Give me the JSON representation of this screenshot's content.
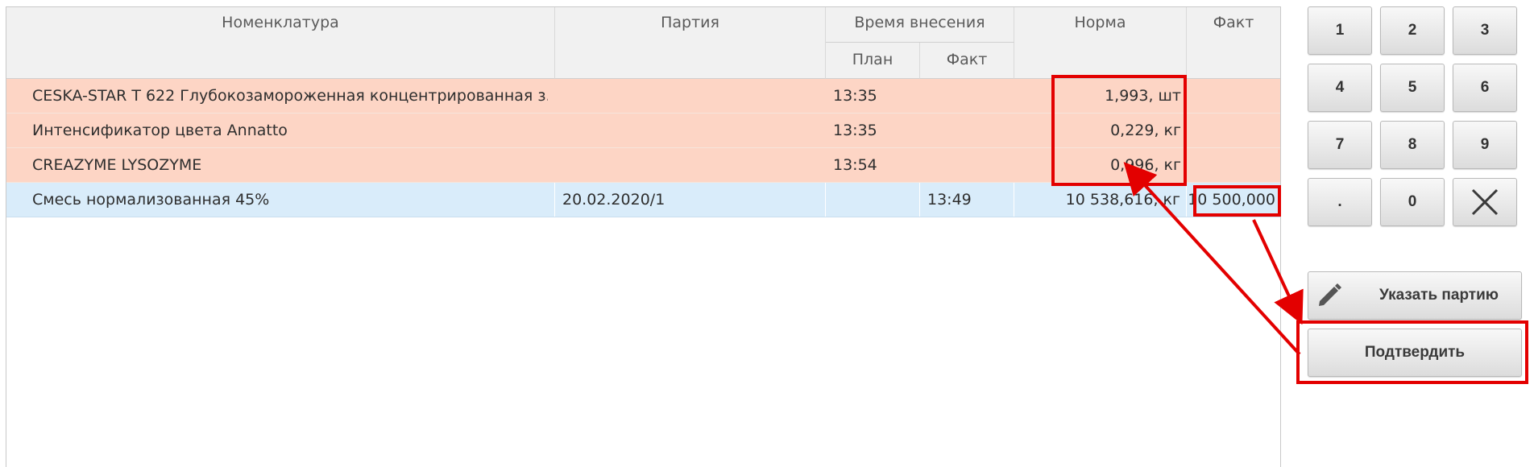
{
  "table": {
    "headers": {
      "item": "Номенклатура",
      "batch": "Партия",
      "time_group": "Время внесения",
      "time_plan": "План",
      "time_fact": "Факт",
      "norm": "Норма",
      "fact": "Факт"
    },
    "rows": [
      {
        "item": "CESKA-STAR T 622 Глубокозамороженная концентрированная з...",
        "batch": "",
        "plan": "13:35",
        "fact_time": "",
        "norm": "1,993, шт",
        "fact": ""
      },
      {
        "item": "Интенсификатор цвета Annatto",
        "batch": "",
        "plan": "13:35",
        "fact_time": "",
        "norm": "0,229, кг",
        "fact": ""
      },
      {
        "item": "CREAZYME LYSOZYME",
        "batch": "",
        "plan": "13:54",
        "fact_time": "",
        "norm": "0,996, кг",
        "fact": ""
      },
      {
        "item": "Смесь нормализованная 45%",
        "batch": "20.02.2020/1",
        "plan": "",
        "fact_time": "13:49",
        "norm": "10 538,616, кг",
        "fact": "10 500,000"
      }
    ]
  },
  "keypad": {
    "keys": [
      "1",
      "2",
      "3",
      "4",
      "5",
      "6",
      "7",
      "8",
      "9",
      ".",
      "0"
    ],
    "clear_icon": "close-icon"
  },
  "actions": {
    "set_batch_label": "Указать партию",
    "set_batch_icon": "pencil-icon",
    "confirm_label": "Подтвердить"
  },
  "colors": {
    "overdue_row": "#fdd5c5",
    "current_row": "#d9ecfa",
    "header_bg": "#f1f1f1",
    "highlight": "#e30000"
  }
}
